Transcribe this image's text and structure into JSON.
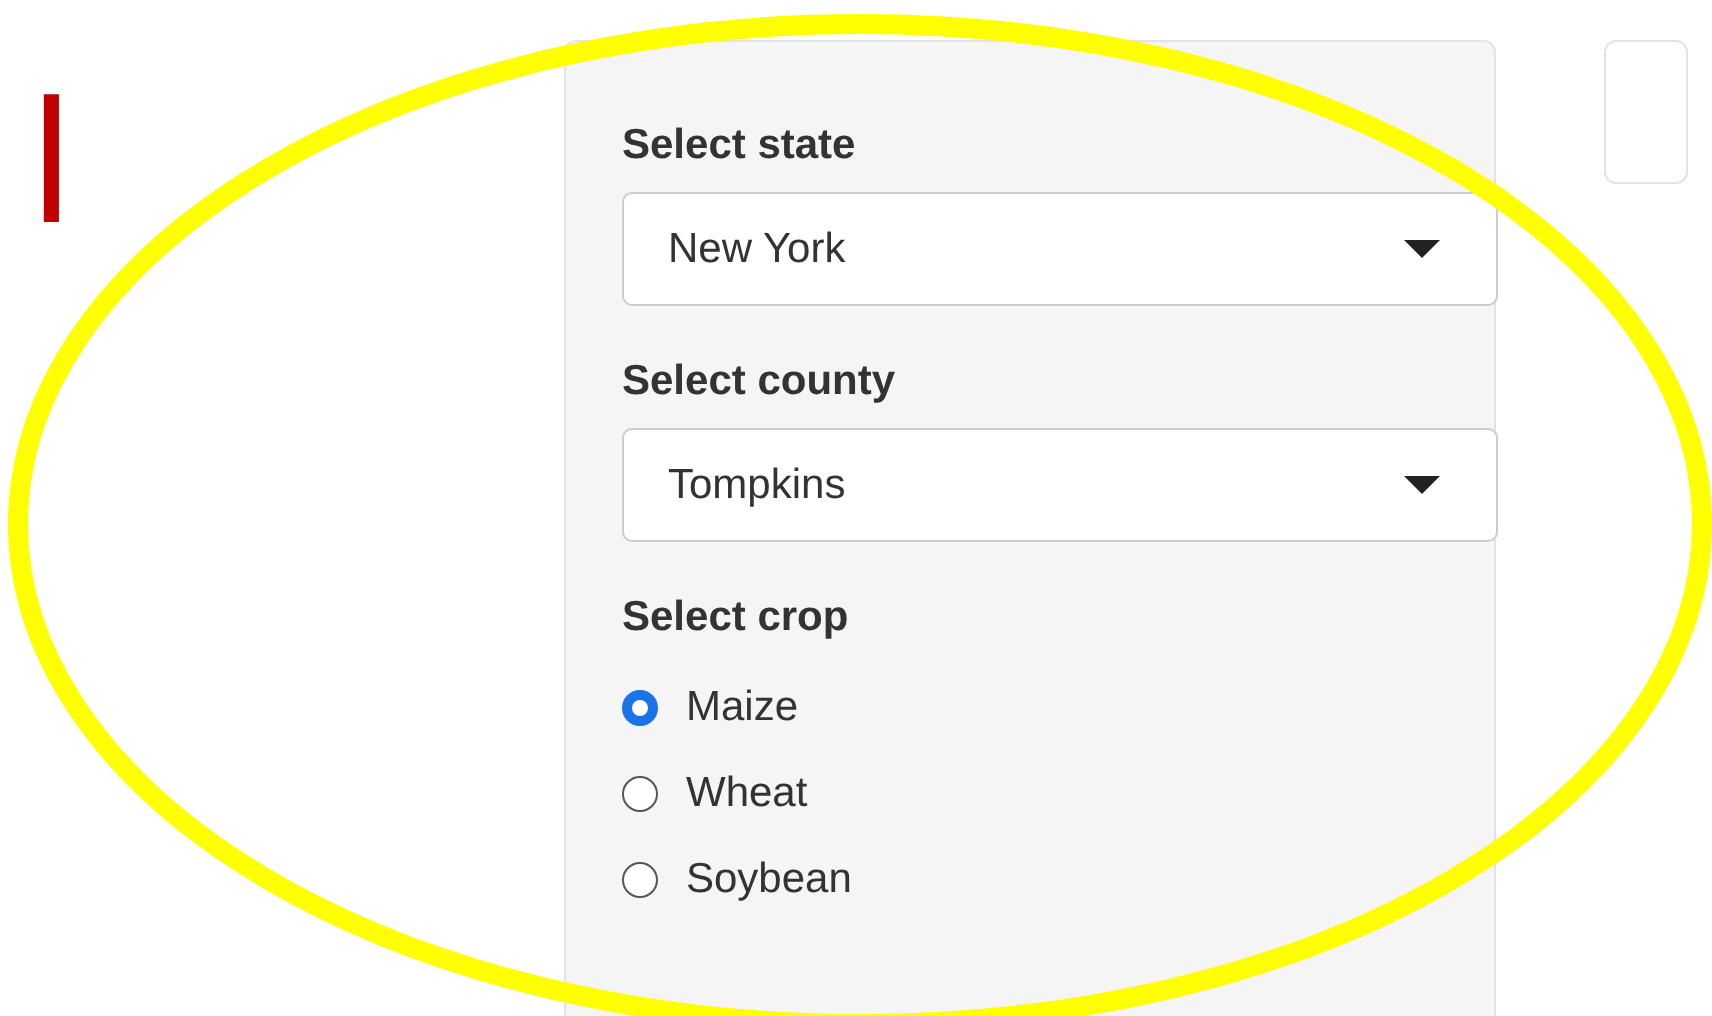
{
  "slide_title": {
    "text": "l"
  },
  "panel": {
    "fields": [
      {
        "kind": "select",
        "label": "Select state",
        "value": "New York"
      },
      {
        "kind": "select",
        "label": "Select county",
        "value": "Tompkins"
      },
      {
        "kind": "radio",
        "label": "Select crop",
        "options": [
          {
            "label": "Maize",
            "selected": true
          },
          {
            "label": "Wheat",
            "selected": false
          },
          {
            "label": "Soybean",
            "selected": false
          }
        ]
      }
    ]
  }
}
